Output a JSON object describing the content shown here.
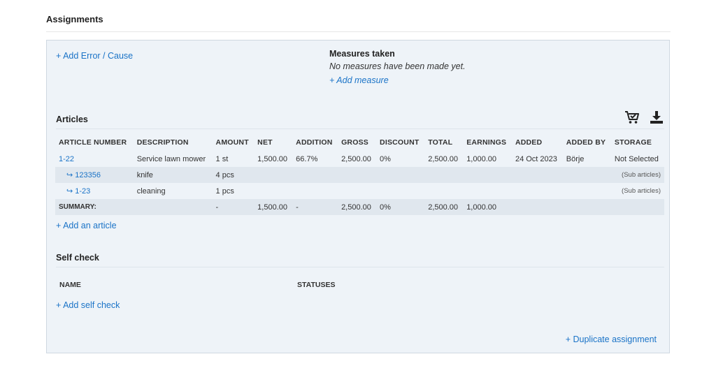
{
  "title": "Assignments",
  "add_error_link": "+ Add Error / Cause",
  "measures": {
    "heading": "Measures taken",
    "empty_text": "No measures have been made yet.",
    "add_link": "+ Add measure"
  },
  "articles": {
    "heading": "Articles",
    "icons": [
      "cart-check-icon",
      "download-icon"
    ],
    "columns": [
      "ARTICLE NUMBER",
      "DESCRIPTION",
      "AMOUNT",
      "NET",
      "ADDITION",
      "GROSS",
      "DISCOUNT",
      "TOTAL",
      "EARNINGS",
      "ADDED",
      "ADDED BY",
      "STORAGE"
    ],
    "rows": [
      {
        "article": "1-22",
        "description": "Service lawn mower",
        "amount": "1 st",
        "net": "1,500.00",
        "addition": "66.7%",
        "gross": "2,500.00",
        "discount": "0%",
        "total": "2,500.00",
        "earnings": "1,000.00",
        "added": "24 Oct 2023",
        "added_by": "Börje",
        "storage": "Not Selected"
      },
      {
        "article": "↪ 123356",
        "description": "knife",
        "amount": "4 pcs",
        "storage": "(Sub articles)"
      },
      {
        "article": "↪ 1-23",
        "description": "cleaning",
        "amount": "1 pcs",
        "storage": "(Sub articles)"
      }
    ],
    "summary": {
      "label": "SUMMARY:",
      "amount": "-",
      "net": "1,500.00",
      "addition": "-",
      "gross": "2,500.00",
      "discount": "0%",
      "total": "2,500.00",
      "earnings": "1,000.00"
    },
    "add_link": "+ Add an article"
  },
  "self_check": {
    "heading": "Self check",
    "col_name": "NAME",
    "col_statuses": "STATUSES",
    "add_link": "+ Add self check"
  },
  "duplicate_link": "+ Duplicate assignment",
  "colors": {
    "link": "#1a73c7",
    "panel": "#eef3f8",
    "row_shade": "#e0e7ee"
  }
}
